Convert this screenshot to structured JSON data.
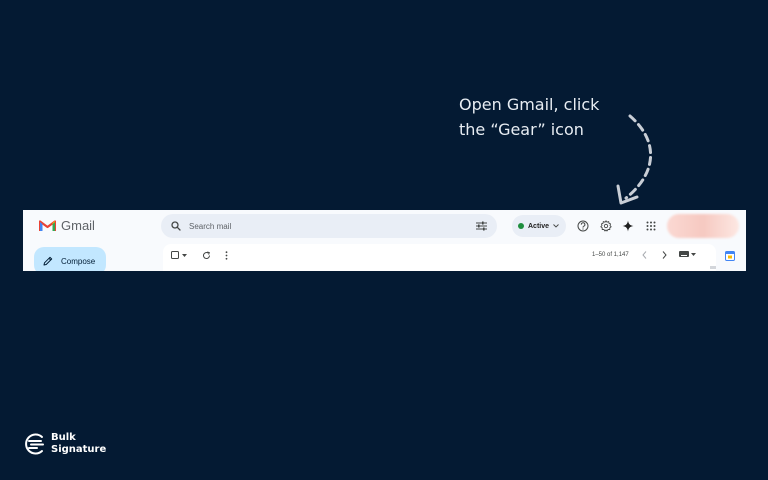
{
  "callout": {
    "line1": "Open Gmail, click",
    "line2": "the “Gear” icon"
  },
  "gmail": {
    "app_name": "Gmail",
    "search": {
      "placeholder": "Search mail"
    },
    "status": {
      "label": "Active",
      "color": "#1e8e3e"
    },
    "header_icons": [
      "help-icon",
      "gear-icon",
      "gemini-sparkle-icon",
      "apps-grid-icon"
    ],
    "compose_label": "Compose",
    "pager_text": "1–50 of 1,147",
    "accent": "#c2e7ff"
  },
  "brand": {
    "line1": "Bulk",
    "line2": "Signature"
  }
}
